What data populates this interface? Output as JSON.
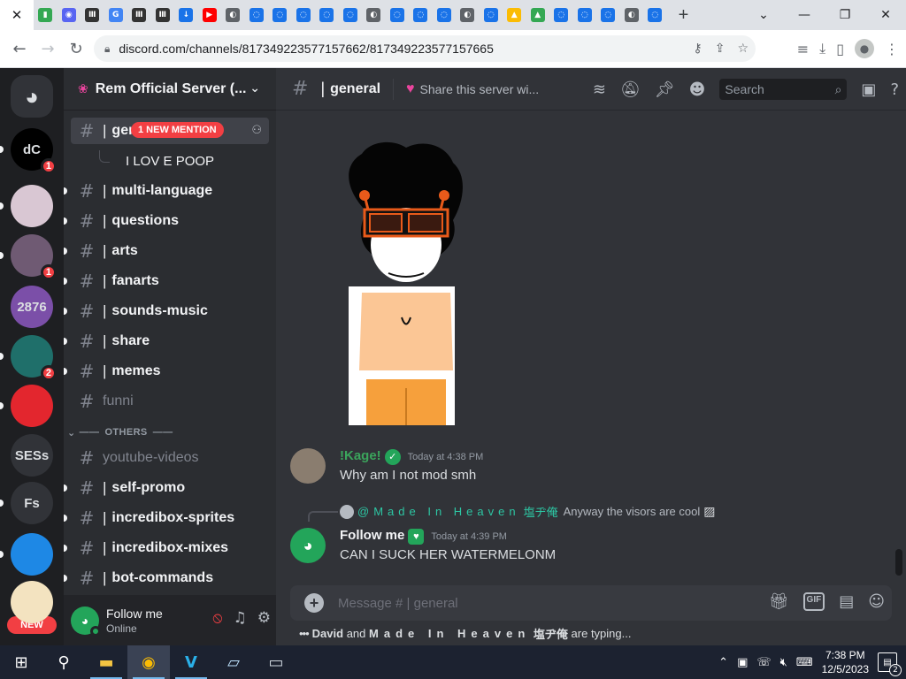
{
  "browser": {
    "tabs": [
      {
        "icon": "close-icon",
        "glyph": "✕",
        "color": "#ffffff"
      },
      {
        "icon": "favicon-green",
        "glyph": "▮",
        "color": "#34a853"
      },
      {
        "icon": "favicon-discord",
        "glyph": "◉",
        "color": "#5865f2"
      },
      {
        "icon": "favicon-museum",
        "glyph": "Ⅲ",
        "color": "#333333"
      },
      {
        "icon": "favicon-google",
        "glyph": "G",
        "color": "#4285f4"
      },
      {
        "icon": "favicon-museum",
        "glyph": "Ⅲ",
        "color": "#333333"
      },
      {
        "icon": "favicon-museum",
        "glyph": "Ⅲ",
        "color": "#333333"
      },
      {
        "icon": "favicon-download",
        "glyph": "↓",
        "color": "#1a73e8"
      },
      {
        "icon": "favicon-youtube",
        "glyph": "▶",
        "color": "#ff0000"
      },
      {
        "icon": "favicon-globe",
        "glyph": "◐",
        "color": "#5f6368"
      },
      {
        "icon": "favicon-swirl",
        "glyph": "◌",
        "color": "#1a73e8"
      },
      {
        "icon": "favicon-swirl",
        "glyph": "◌",
        "color": "#1a73e8"
      },
      {
        "icon": "favicon-swirl",
        "glyph": "◌",
        "color": "#1a73e8"
      },
      {
        "icon": "favicon-swirl",
        "glyph": "◌",
        "color": "#1a73e8"
      },
      {
        "icon": "favicon-swirl",
        "glyph": "◌",
        "color": "#1a73e8"
      },
      {
        "icon": "favicon-globe",
        "glyph": "◐",
        "color": "#5f6368"
      },
      {
        "icon": "favicon-swirl",
        "glyph": "◌",
        "color": "#1a73e8"
      },
      {
        "icon": "favicon-swirl",
        "glyph": "◌",
        "color": "#1a73e8"
      },
      {
        "icon": "favicon-swirl",
        "glyph": "◌",
        "color": "#1a73e8"
      },
      {
        "icon": "favicon-globe",
        "glyph": "◐",
        "color": "#5f6368"
      },
      {
        "icon": "favicon-swirl",
        "glyph": "◌",
        "color": "#1a73e8"
      },
      {
        "icon": "favicon-drive",
        "glyph": "▲",
        "color": "#fbbc04"
      },
      {
        "icon": "favicon-drive",
        "glyph": "▲",
        "color": "#34a853"
      },
      {
        "icon": "favicon-swirl",
        "glyph": "◌",
        "color": "#1a73e8"
      },
      {
        "icon": "favicon-swirl",
        "glyph": "◌",
        "color": "#1a73e8"
      },
      {
        "icon": "favicon-swirl",
        "glyph": "◌",
        "color": "#1a73e8"
      },
      {
        "icon": "favicon-globe",
        "glyph": "◐",
        "color": "#5f6368"
      },
      {
        "icon": "favicon-swirl",
        "glyph": "◌",
        "color": "#1a73e8"
      }
    ],
    "url": "discord.com/channels/817349223577157662/817349223577157665"
  },
  "server": {
    "name": "Rem Official Server (...",
    "mention_pill": "1 NEW MENTION"
  },
  "channels": [
    {
      "name": "general",
      "kind": "channel",
      "state": "active"
    },
    {
      "name": "I LOV E POOP",
      "kind": "thread",
      "state": "unread"
    },
    {
      "name": "multi-language",
      "kind": "channel",
      "state": "unread"
    },
    {
      "name": "questions",
      "kind": "channel",
      "state": "unread"
    },
    {
      "name": "arts",
      "kind": "channel",
      "state": "unread"
    },
    {
      "name": "fanarts",
      "kind": "channel",
      "state": "unread"
    },
    {
      "name": "sounds-music",
      "kind": "channel",
      "state": "unread"
    },
    {
      "name": "share",
      "kind": "channel",
      "state": "unread"
    },
    {
      "name": "memes",
      "kind": "channel",
      "state": "unread"
    },
    {
      "name": "funni",
      "kind": "channel",
      "state": "muted"
    },
    {
      "name": "OTHERS",
      "kind": "category",
      "state": ""
    },
    {
      "name": "youtube-videos",
      "kind": "channel",
      "state": "muted"
    },
    {
      "name": "self-promo",
      "kind": "channel",
      "state": "unread"
    },
    {
      "name": "incredibox-sprites",
      "kind": "channel",
      "state": "unread"
    },
    {
      "name": "incredibox-mixes",
      "kind": "channel",
      "state": "unread"
    },
    {
      "name": "bot-commands",
      "kind": "channel",
      "state": "unread"
    }
  ],
  "guilds": [
    {
      "label": "",
      "icon": "discord-home-icon",
      "color": "#313338",
      "badge": ""
    },
    {
      "label": "dC",
      "icon": "guild-dc-icon",
      "color": "#000000",
      "badge": "1"
    },
    {
      "label": "",
      "icon": "guild-anime-icon",
      "color": "#d9c7d3",
      "badge": ""
    },
    {
      "label": "",
      "icon": "guild-rem-icon",
      "color": "#6f5a73",
      "badge": "1"
    },
    {
      "label": "2876",
      "icon": "guild-2876-icon",
      "color": "#7b4fa8",
      "badge": ""
    },
    {
      "label": "",
      "icon": "guild-teal-icon",
      "color": "#1f6f6a",
      "badge": "2"
    },
    {
      "label": "",
      "icon": "guild-red-icon",
      "color": "#e3262e",
      "badge": ""
    },
    {
      "label": "SESs",
      "icon": "guild-sess-icon",
      "color": "#313338",
      "badge": ""
    },
    {
      "label": "Fs",
      "icon": "guild-fs-icon",
      "color": "#313338",
      "badge": ""
    },
    {
      "label": "",
      "icon": "guild-blue-icon",
      "color": "#1e88e5",
      "badge": ""
    },
    {
      "label": "",
      "icon": "guild-gold-icon",
      "color": "#f3e3c0",
      "badge": ""
    }
  ],
  "new_tag": "NEW",
  "user_panel": {
    "name": "Follow me",
    "status": "Online"
  },
  "chat": {
    "channel": "general",
    "topic": "Share this server wi...",
    "search_placeholder": "Search",
    "composer_placeholder": "Message # | general",
    "messages": [
      {
        "author": "!Kage!",
        "author_color": "#3ba55c",
        "verified": true,
        "time": "Today at 4:38 PM",
        "text": "Why am I not mod smh"
      },
      {
        "author": "Follow me",
        "author_color": "#f2f3f5",
        "verified": false,
        "time": "Today at 4:39 PM",
        "text": "CAN I  SUCK HER WATERMELONM"
      }
    ],
    "reply": {
      "name": "@Made In Heaven",
      "tag": "塩ヂ俺",
      "text": "Anyway the visors are cool"
    },
    "typing": {
      "user1": "David",
      "and": "and",
      "user2": "Made In Heaven",
      "tag": "塩ヂ俺",
      "suffix": "are typing..."
    }
  },
  "taskbar": {
    "time": "7:38 PM",
    "date": "12/5/2023",
    "notifications": "2"
  }
}
